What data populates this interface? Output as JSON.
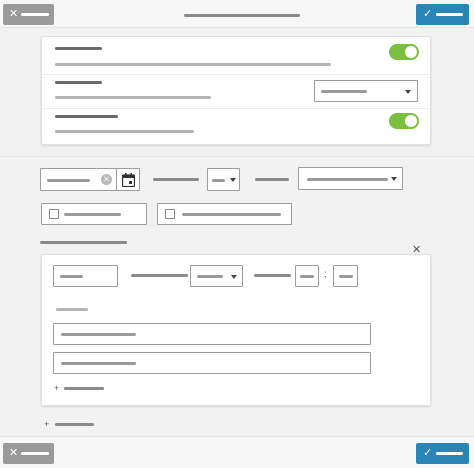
{
  "colors": {
    "primary": "#2a86b6",
    "cancel": "#9a9a9a",
    "toggle_on": "#7cbf3f"
  },
  "icons": {
    "close": "✕",
    "check": "✓",
    "calendar": "calendar-icon",
    "clear": "⨯",
    "plus": "+",
    "colon": ":"
  },
  "settings": {
    "toggle_1_on": true,
    "toggle_2_on": true
  },
  "dialog": {
    "time_separator": ":"
  }
}
